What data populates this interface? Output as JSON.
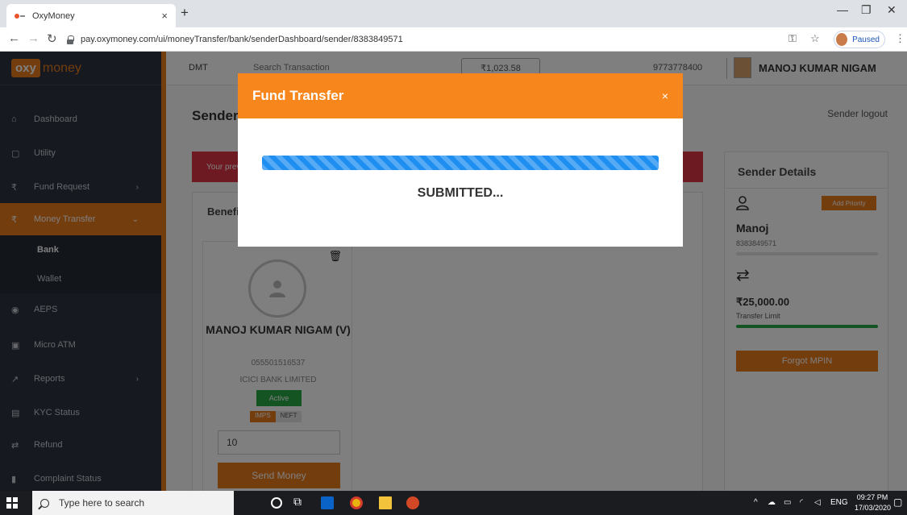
{
  "browser": {
    "tab_title": "OxyMoney",
    "tab_close": "×",
    "new_tab": "+",
    "url": "pay.oxymoney.com/ui/moneyTransfer/bank/senderDashboard/sender/8383849571",
    "profile_status": "Paused"
  },
  "app": {
    "logo_primary": "oxy",
    "logo_secondary": "money",
    "topnav": {
      "service": "DMT",
      "search_placeholder": "Search Transaction",
      "balance": "₹1,023.58",
      "phone": "9773778400",
      "user_name": "MANOJ KUMAR NIGAM"
    },
    "sidebar": {
      "items": [
        {
          "label": "Dashboard"
        },
        {
          "label": "Utility"
        },
        {
          "label": "Fund Request"
        },
        {
          "label": "Money Transfer"
        },
        {
          "label": "AEPS"
        },
        {
          "label": "Micro ATM"
        },
        {
          "label": "Reports"
        },
        {
          "label": "KYC Status"
        },
        {
          "label": "Refund"
        },
        {
          "label": "Complaint Status"
        }
      ],
      "sub_items": [
        {
          "label": "Bank"
        },
        {
          "label": "Wallet"
        }
      ]
    },
    "main": {
      "page_title": "Sender",
      "sender_logout": "Sender logout",
      "alert_text": "Your prev",
      "beneficiary_title": "Benefi",
      "beneficiary": {
        "name": "MANOJ KUMAR NIGAM (V)",
        "account": "055501516537",
        "bank": "ICICI BANK LIMITED",
        "status": "Active",
        "mode_imps": "IMPS",
        "mode_neft": "NEFT",
        "amount": "10",
        "send_label": "Send Money"
      }
    },
    "sender_details": {
      "title": "Sender Details",
      "add_priority": "Add Priority",
      "name": "Manoj",
      "phone": "8383849571",
      "transfer_limit": "₹25,000.00",
      "transfer_limit_label": "Transfer Limit",
      "limit_fraction": 1.0,
      "forgot_mpin": "Forgot MPIN"
    }
  },
  "modal": {
    "title": "Fund Transfer",
    "close": "×",
    "progress_fraction": 1.0,
    "status_text": "SUBMITTED..."
  },
  "taskbar": {
    "search_placeholder": "Type here to search",
    "language": "ENG",
    "time": "09:27 PM",
    "date": "17/03/2020"
  },
  "colors": {
    "brand_orange": "#e87a1c",
    "modal_header": "#f7861c",
    "progress_blue": "#1f8ef1",
    "active_green": "#28a745",
    "alert_red": "#dc3545"
  }
}
